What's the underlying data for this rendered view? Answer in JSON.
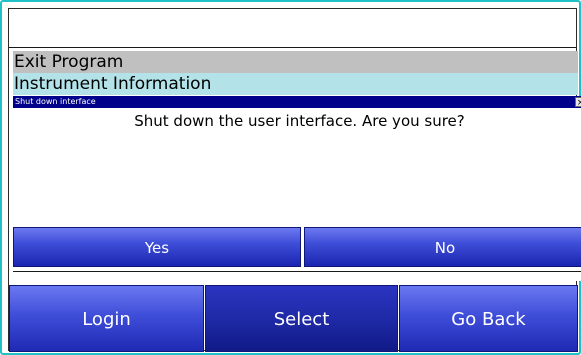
{
  "menu": {
    "items": [
      {
        "label": "Exit Program"
      },
      {
        "label": "Instrument Information"
      }
    ]
  },
  "dialog": {
    "title": "Shut down interface",
    "close_glyph": "×",
    "message": "Shut down the user interface.  Are you sure?",
    "yes_label": "Yes",
    "no_label": "No"
  },
  "nav": {
    "login_label": "Login",
    "select_label": "Select",
    "back_label": "Go Back"
  },
  "colors": {
    "frame_border": "#1fc0c8",
    "title_bar": "#00008b",
    "selected_item": "#c0c0c0",
    "highlight_item": "#b3e2e8",
    "button_blue": "#3f4ed8"
  }
}
